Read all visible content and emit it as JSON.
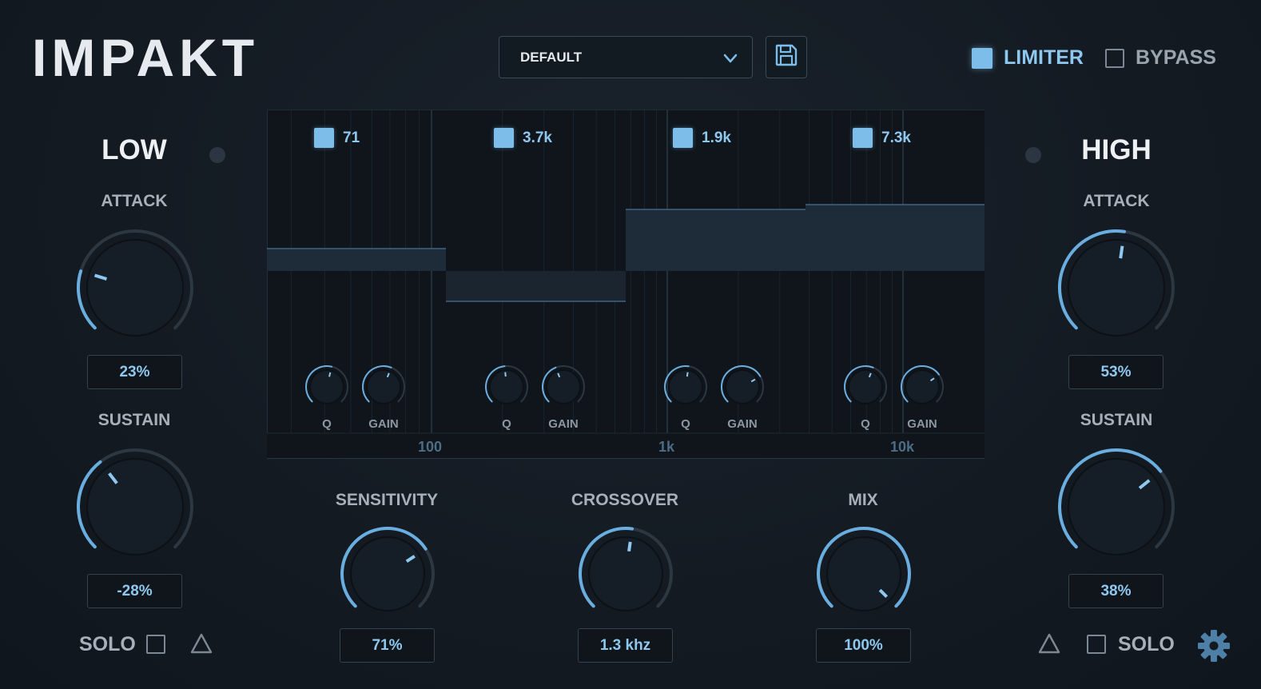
{
  "app": {
    "title": "IMPAKT"
  },
  "header": {
    "preset_value": "DEFAULT",
    "limiter_label": "LIMITER",
    "limiter_checked": true,
    "bypass_label": "BYPASS",
    "bypass_checked": false
  },
  "low": {
    "title": "LOW",
    "attack_label": "ATTACK",
    "attack_value": "23%",
    "sustain_label": "SUSTAIN",
    "sustain_value": "-28%",
    "solo_label": "SOLO"
  },
  "high": {
    "title": "HIGH",
    "attack_label": "ATTACK",
    "attack_value": "53%",
    "sustain_label": "SUSTAIN",
    "sustain_value": "38%",
    "solo_label": "SOLO"
  },
  "eq": {
    "bands": [
      {
        "freq": "71",
        "q_label": "Q",
        "gain_label": "GAIN"
      },
      {
        "freq": "3.7k",
        "q_label": "Q",
        "gain_label": "GAIN"
      },
      {
        "freq": "1.9k",
        "q_label": "Q",
        "gain_label": "GAIN"
      },
      {
        "freq": "7.3k",
        "q_label": "Q",
        "gain_label": "GAIN"
      }
    ],
    "axis": [
      "100",
      "1k",
      "10k"
    ]
  },
  "bottom": {
    "sensitivity_label": "SENSITIVITY",
    "sensitivity_value": "71%",
    "crossover_label": "CROSSOVER",
    "crossover_value": "1.3 khz",
    "mix_label": "MIX",
    "mix_value": "100%"
  },
  "colors": {
    "accent": "#7dbdea",
    "background": "#131a22",
    "value_text": "#8fc8ef"
  }
}
